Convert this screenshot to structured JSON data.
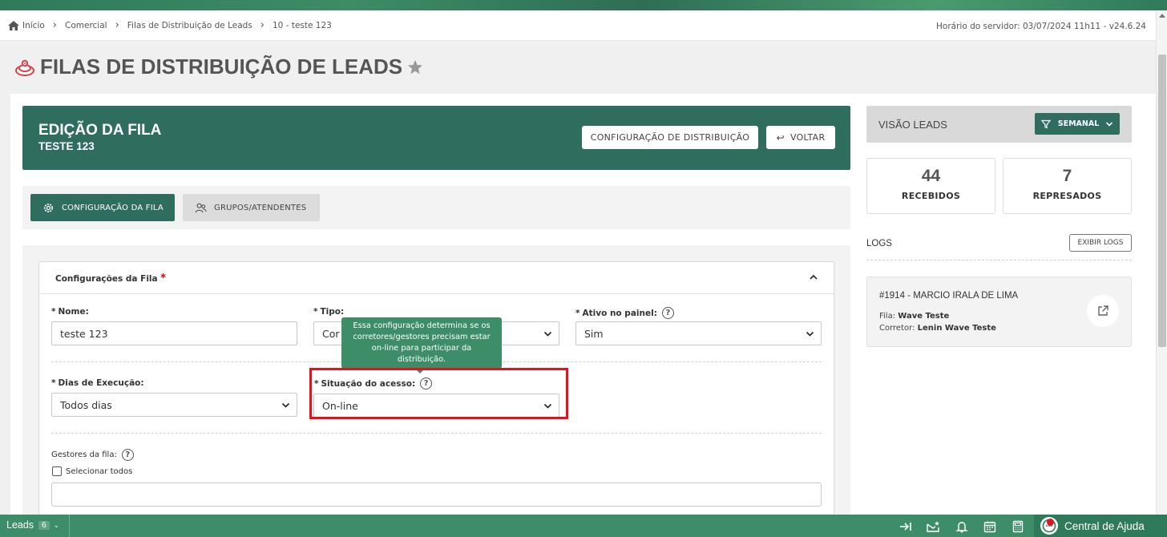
{
  "breadcrumb": {
    "items": [
      "Início",
      "Comercial",
      "Filas de Distribuição de Leads",
      "10 - teste 123"
    ],
    "server_time": "Horário do servidor: 03/07/2024 11h11 - v24.6.24"
  },
  "page": {
    "title": "FILAS DE DISTRIBUIÇÃO DE LEADS"
  },
  "edit_header": {
    "title": "EDIÇÃO DA FILA",
    "subtitle": "TESTE 123",
    "config_button": "CONFIGURAÇÃO DE DISTRIBUIÇÃO",
    "back_button": "VOLTAR"
  },
  "tabs": [
    {
      "label": "CONFIGURAÇÃO DA FILA",
      "active": true
    },
    {
      "label": "GRUPOS/ATENDENTES",
      "active": false
    }
  ],
  "form": {
    "card_title": "Configurações da Fila",
    "required_marker": "*",
    "nome": {
      "label": "Nome:",
      "value": "teste 123"
    },
    "tipo": {
      "label": "Tipo:",
      "value": "Cor"
    },
    "ativo": {
      "label": "Ativo no painel:",
      "value": "Sim"
    },
    "dias": {
      "label": "Dias de Execução:",
      "value": "Todos dias"
    },
    "situacao": {
      "label": "Situação do acesso:",
      "value": "On-line"
    },
    "gestores": {
      "label": "Gestores da fila:",
      "select_all": "Selecionar todos"
    },
    "tooltip": "Essa configuração determina se os corretores/gestores precisam estar on-line para participar da distribuição."
  },
  "sidebar": {
    "title": "VISÃO LEADS",
    "period_button": "SEMANAL",
    "stats": [
      {
        "value": "44",
        "label": "RECEBIDOS"
      },
      {
        "value": "7",
        "label": "REPRESADOS"
      }
    ],
    "logs_label": "LOGS",
    "logs_button": "EXIBIR LOGS",
    "log_entry": {
      "title": "#1914 - MARCIO IRALA DE LIMA",
      "fila_label": "Fila:",
      "fila_value": "Wave Teste",
      "corretor_label": "Corretor:",
      "corretor_value": "Lenin Wave Teste"
    }
  },
  "bottombar": {
    "leads_label": "Leads",
    "leads_count": "6",
    "help_center": "Central de Ajuda"
  },
  "colors": {
    "primary": "#2f6e5f",
    "accent": "#3d8e68",
    "highlight": "#e0141e"
  }
}
